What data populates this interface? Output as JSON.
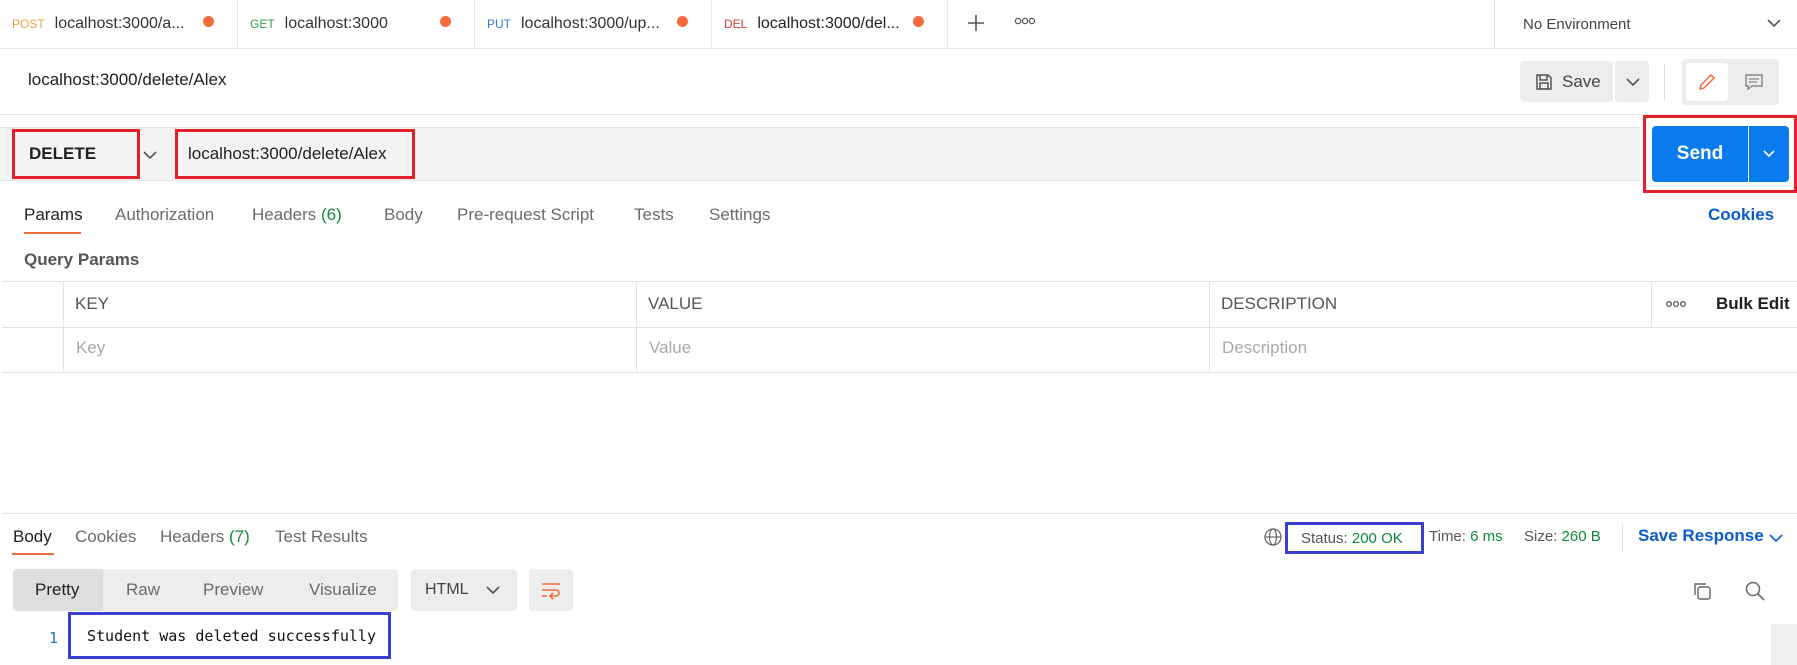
{
  "tabs": [
    {
      "method": "POST",
      "method_color": "#e9a23b",
      "url": "localhost:3000/a..."
    },
    {
      "method": "GET",
      "method_color": "#2c9e4b",
      "url": "localhost:3000"
    },
    {
      "method": "PUT",
      "method_color": "#2f7fd6",
      "url": "localhost:3000/up..."
    },
    {
      "method": "DEL",
      "method_color": "#d83a3a",
      "url": "localhost:3000/del..."
    }
  ],
  "environment": "No Environment",
  "request": {
    "title": "localhost:3000/delete/Alex",
    "save_label": "Save",
    "method": "DELETE",
    "url": "localhost:3000/delete/Alex",
    "send_label": "Send"
  },
  "request_tabs": {
    "params": "Params",
    "authorization": "Authorization",
    "headers": "Headers",
    "headers_count": "(6)",
    "body": "Body",
    "prerequest": "Pre-request Script",
    "tests": "Tests",
    "settings": "Settings",
    "cookies": "Cookies"
  },
  "query_params": {
    "title": "Query Params",
    "columns": [
      "KEY",
      "VALUE",
      "DESCRIPTION"
    ],
    "placeholders": [
      "Key",
      "Value",
      "Description"
    ],
    "bulk_edit": "Bulk Edit"
  },
  "response": {
    "tabs": {
      "body": "Body",
      "cookies": "Cookies",
      "headers": "Headers",
      "headers_count": "(7)",
      "test_results": "Test Results"
    },
    "status_label": "Status:",
    "status_value": "200 OK",
    "time_label": "Time:",
    "time_value": "6 ms",
    "size_label": "Size:",
    "size_value": "260 B",
    "save_response": "Save Response",
    "views": [
      "Pretty",
      "Raw",
      "Preview",
      "Visualize"
    ],
    "format": "HTML",
    "line_number": "1",
    "body_text": "Student was deleted successfully"
  },
  "colors": {
    "accent_orange": "#f26b3a",
    "send_blue": "#097bed",
    "status_green": "#0f8a3c",
    "highlight_red": "#e0202a",
    "highlight_blue": "#3a3fcf"
  }
}
